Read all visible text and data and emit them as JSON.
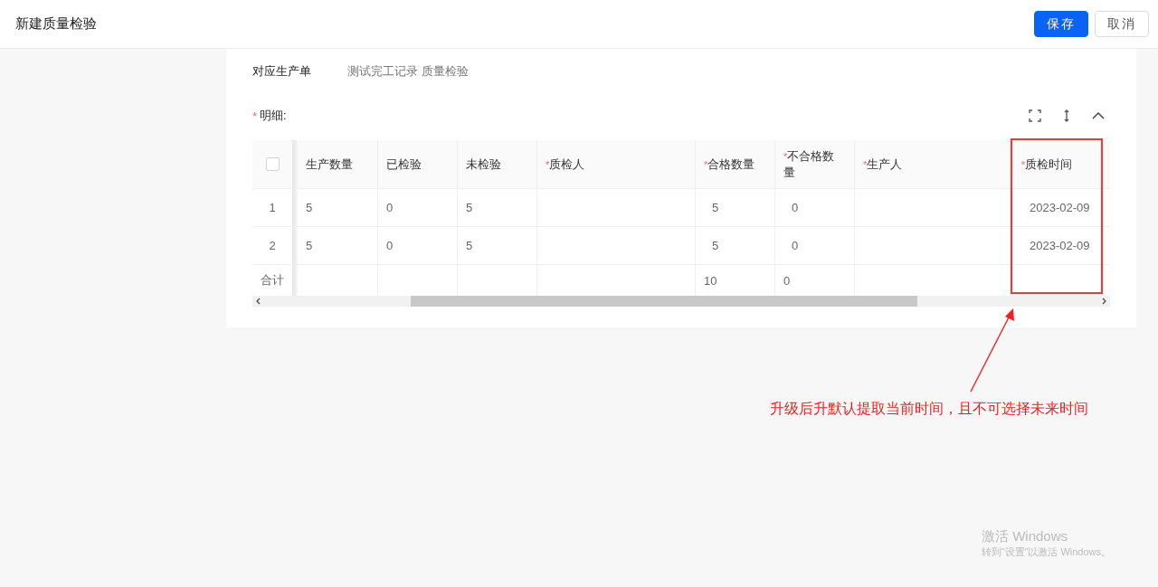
{
  "header": {
    "title": "新建质量检验",
    "buttons": [
      {
        "label": "保存",
        "kind": "primary"
      },
      {
        "label": "取消",
        "kind": "default"
      }
    ]
  },
  "form": {
    "field_label": "对应生产单",
    "field_value": "测试完工记录 质量检验",
    "section_label": "明细:",
    "section_mark": "*"
  },
  "table": {
    "select_all_checked": false,
    "columns": [
      {
        "label": "生产数量",
        "kind": "text"
      },
      {
        "label": "已检验",
        "kind": "text"
      },
      {
        "label": "未检验",
        "kind": "text"
      },
      {
        "label": "质检人",
        "mark": "*",
        "kind": "wide"
      },
      {
        "label": "合格数量",
        "mark": "*",
        "kind": "input"
      },
      {
        "label": "不合格数量",
        "mark": "*",
        "kind": "input"
      },
      {
        "label": "生产人",
        "mark": "*",
        "kind": "wide"
      },
      {
        "label": "质检时间",
        "mark": "*",
        "kind": "date"
      }
    ],
    "rows": [
      {
        "index": "1",
        "cells": [
          "5",
          "0",
          "5",
          null,
          "5",
          "0",
          null,
          "2023-02-09"
        ]
      },
      {
        "index": "2",
        "cells": [
          "5",
          "0",
          "5",
          null,
          "5",
          "0",
          null,
          "2023-02-09"
        ]
      }
    ],
    "summary": {
      "label": "合计",
      "cells": [
        null,
        null,
        null,
        null,
        "10",
        "0",
        null,
        null
      ]
    }
  },
  "annotation": {
    "text": "升级后升默认提取当前时间，且不可选择未来时间"
  },
  "os_overlay": {
    "title": "激活 Windows",
    "subtitle": "转到“设置”以激活 Windows。"
  }
}
